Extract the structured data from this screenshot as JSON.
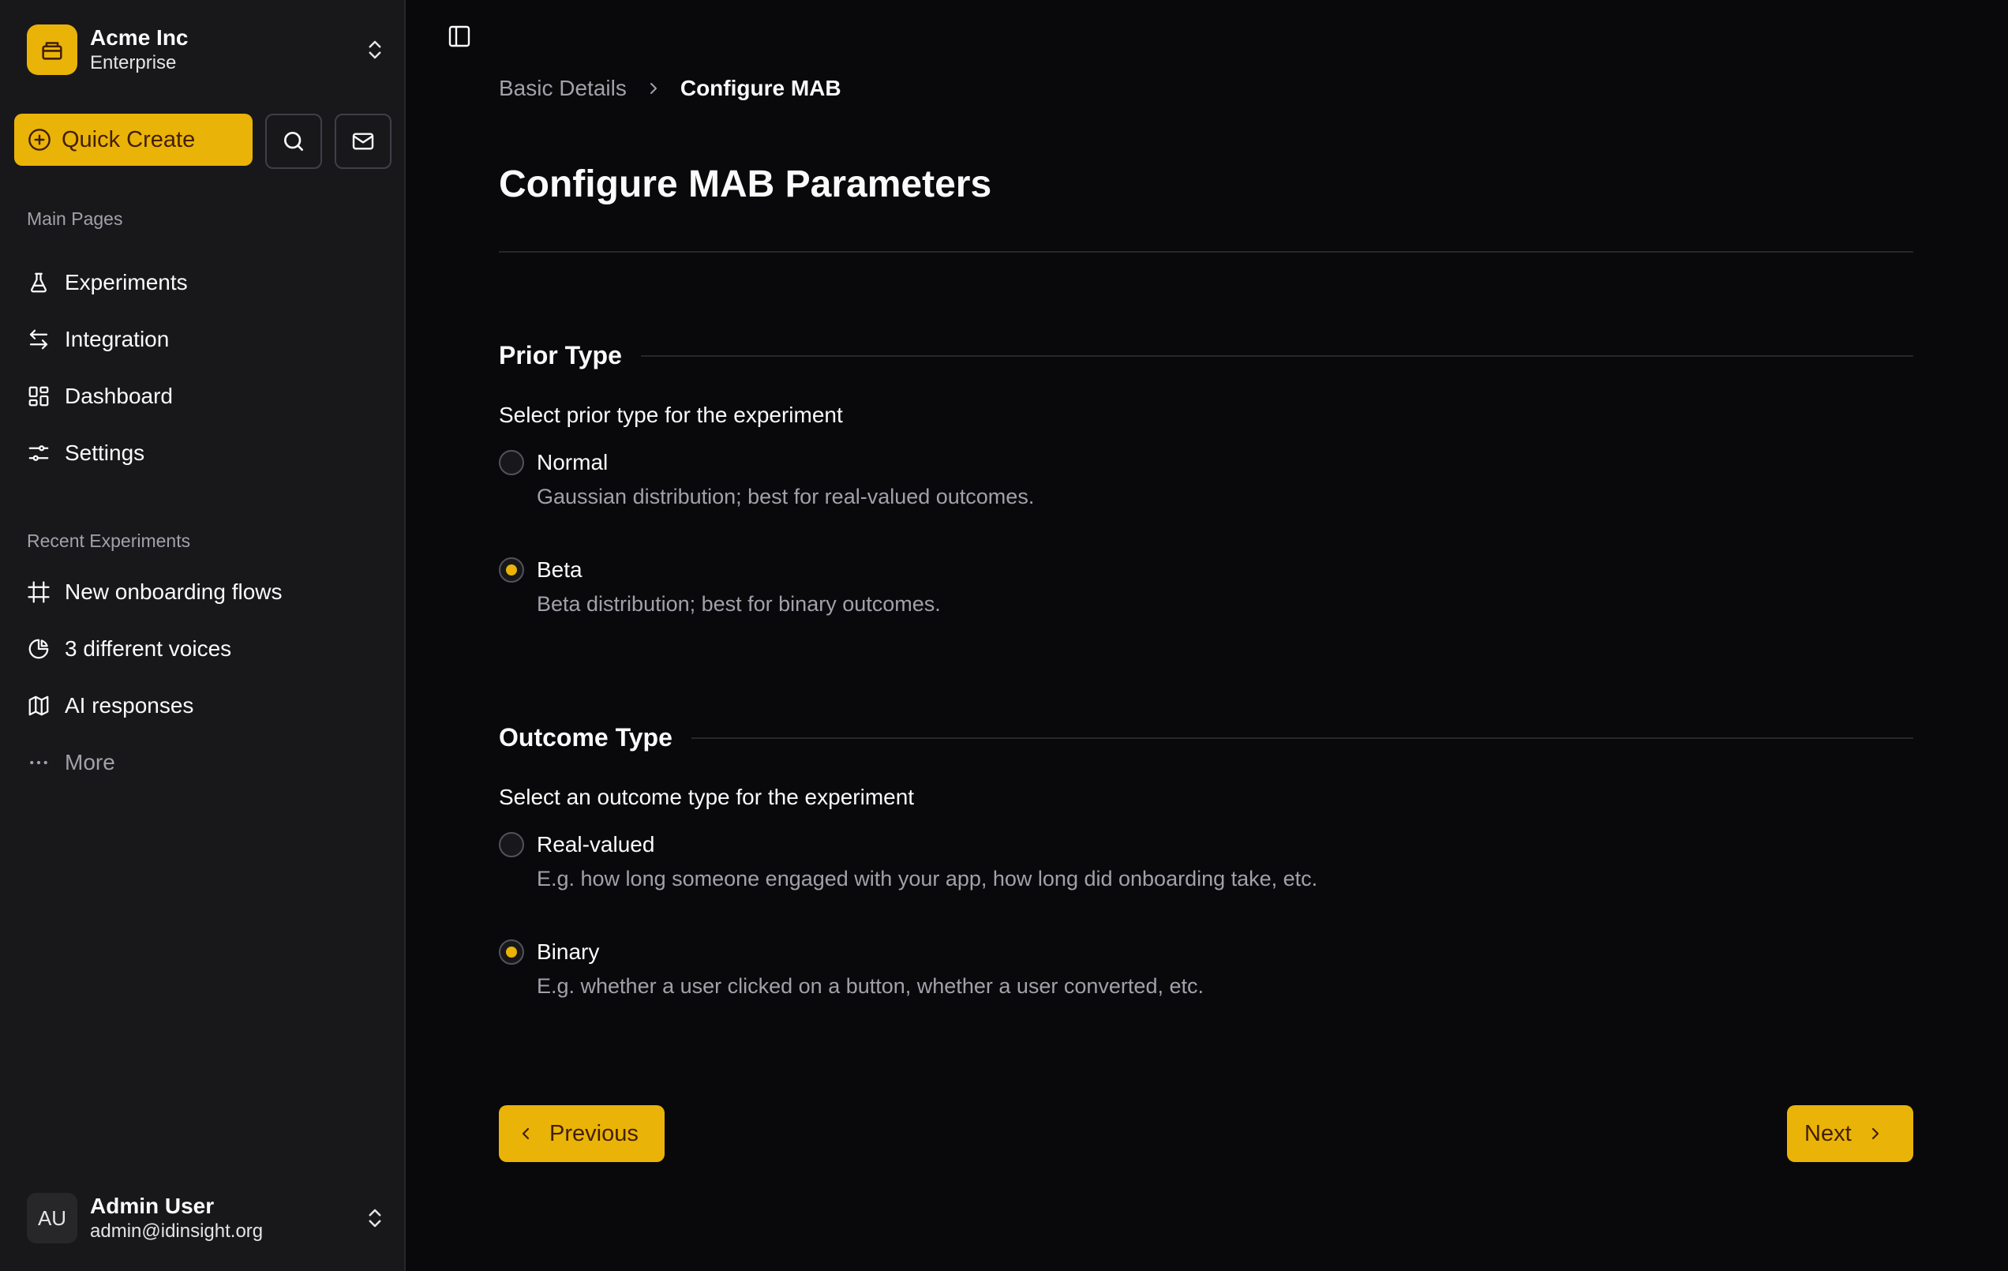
{
  "org": {
    "name": "Acme Inc",
    "plan": "Enterprise"
  },
  "quick_create": {
    "label": "Quick Create"
  },
  "sidebar": {
    "main_label": "Main Pages",
    "main_items": [
      {
        "label": "Experiments",
        "icon": "flask-icon"
      },
      {
        "label": "Integration",
        "icon": "arrows-swap-icon"
      },
      {
        "label": "Dashboard",
        "icon": "dashboard-icon"
      },
      {
        "label": "Settings",
        "icon": "sliders-icon"
      }
    ],
    "recent_label": "Recent Experiments",
    "recent_items": [
      {
        "label": "New onboarding flows",
        "icon": "frame-icon"
      },
      {
        "label": "3 different voices",
        "icon": "pie-chart-icon"
      },
      {
        "label": "AI responses",
        "icon": "map-icon"
      },
      {
        "label": "More",
        "icon": "ellipsis-icon"
      }
    ]
  },
  "user": {
    "initials": "AU",
    "name": "Admin User",
    "email": "admin@idinsight.org"
  },
  "breadcrumb": {
    "step1": "Basic Details",
    "step2": "Configure MAB"
  },
  "page_title": "Configure MAB Parameters",
  "prior": {
    "heading": "Prior Type",
    "subtitle": "Select prior type for the experiment",
    "options": [
      {
        "label": "Normal",
        "desc": "Gaussian distribution; best for real-valued outcomes.",
        "checked": false
      },
      {
        "label": "Beta",
        "desc": "Beta distribution; best for binary outcomes.",
        "checked": true
      }
    ]
  },
  "outcome": {
    "heading": "Outcome Type",
    "subtitle": "Select an outcome type for the experiment",
    "options": [
      {
        "label": "Real-valued",
        "desc": "E.g. how long someone engaged with your app, how long did onboarding take, etc.",
        "checked": false
      },
      {
        "label": "Binary",
        "desc": "E.g. whether a user clicked on a button, whether a user converted, etc.",
        "checked": true
      }
    ]
  },
  "buttons": {
    "previous": "Previous",
    "next": "Next"
  },
  "colors": {
    "accent": "#eab308",
    "background": "#09090b",
    "sidebar": "#18181b"
  }
}
